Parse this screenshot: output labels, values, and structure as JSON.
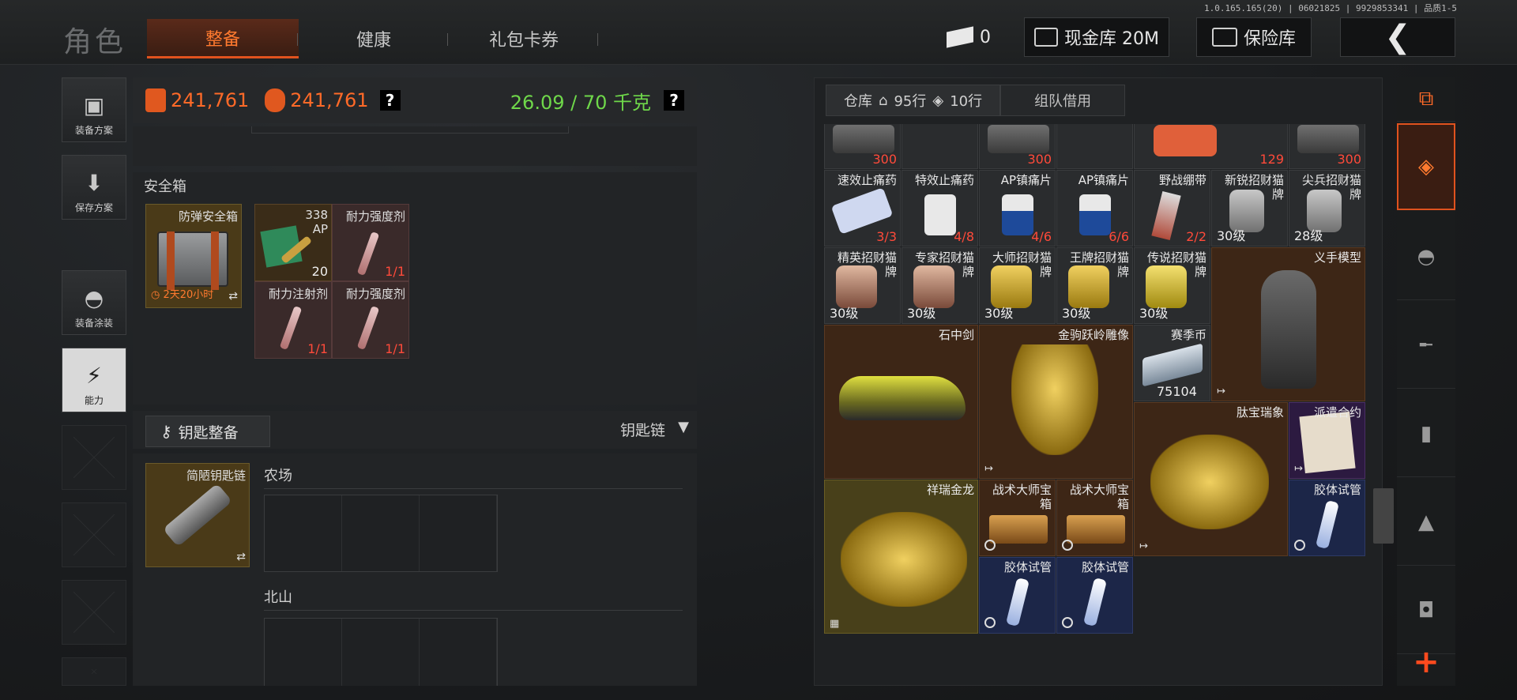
{
  "version": "1.0.165.165(20) | 06021825 | 9929853341 | 品质1-5",
  "title": "角色",
  "tabs": [
    "整备",
    "健康",
    "礼包卡券"
  ],
  "top_right": {
    "tickets_count": "0",
    "cash_vault": "现金库 20M",
    "insurance": "保险库",
    "back_icon": "back-arrow-icon"
  },
  "left_nav": [
    {
      "label": "装备方案",
      "icon": "vest-icon"
    },
    {
      "label": "保存方案",
      "icon": "download-icon"
    },
    {
      "label": "装备涂装",
      "icon": "helmet-icon"
    },
    {
      "label": "能力",
      "icon": "lightning-icon"
    }
  ],
  "stats": {
    "value1": "241,761",
    "value2": "241,761",
    "weight": "26.09 / 70 千克"
  },
  "safe_box": {
    "title": "安全箱",
    "container": {
      "name": "防弹安全箱",
      "timer": "2天20小时"
    },
    "items": [
      {
        "name": "338\nAP",
        "count": "20",
        "white": true
      },
      {
        "name": "耐力强度剂",
        "count": "1/1"
      },
      {
        "name": "耐力注射剂",
        "count": "1/1"
      },
      {
        "name": "耐力强度剂",
        "count": "1/1"
      }
    ]
  },
  "key_section": {
    "button": "钥匙整备",
    "chain_label": "钥匙链",
    "key_name": "简陋钥匙链",
    "maps": [
      "农场",
      "北山"
    ]
  },
  "warehouse": {
    "tab_name": "仓库",
    "rows_a": "95行",
    "rows_b": "10行",
    "team_tab": "组队借用",
    "top_counts": [
      "300",
      "300",
      "129",
      "300"
    ],
    "row1": [
      {
        "name": "速效止痛药",
        "count": "3/3"
      },
      {
        "name": "特效止痛药",
        "count": "4/8"
      },
      {
        "name": "AP镇痛片",
        "count": "4/6"
      },
      {
        "name": "AP镇痛片",
        "count": "6/6"
      },
      {
        "name": "野战绷带",
        "count": "2/2"
      },
      {
        "name": "新锐招财猫\n牌",
        "lv": "30级"
      },
      {
        "name": "尖兵招财猫\n牌",
        "lv": "28级"
      }
    ],
    "row2": [
      {
        "name": "精英招财猫\n牌",
        "lv": "30级"
      },
      {
        "name": "专家招财猫\n牌",
        "lv": "30级"
      },
      {
        "name": "大师招财猫\n牌",
        "lv": "30级"
      },
      {
        "name": "王牌招财猫\n牌",
        "lv": "30级"
      },
      {
        "name": "传说招财猫\n牌",
        "lv": "30级"
      }
    ],
    "prosthetic": "义手模型",
    "sword": "石中剑",
    "horse": "金驹跃岭雕像",
    "coin": {
      "name": "赛季币",
      "count": "75104"
    },
    "elephant": "肽宝瑞象",
    "contract": "派遣合约",
    "dragon": "祥瑞金龙",
    "chest1": "战术大师宝\n箱",
    "chest2": "战术大师宝\n箱",
    "tube1": "胶体试管",
    "tube2": "胶体试管",
    "tube3": "胶体试管"
  },
  "side_icons": [
    "layers-refresh-icon",
    "layers-icon",
    "helmet-icon",
    "rifle-icon",
    "magazine-icon",
    "bullet-icon",
    "sight-icon",
    "plus-icon"
  ],
  "colors": {
    "accent": "#e0521e",
    "weight_green": "#6fd84a",
    "count_red": "#ff4a3a"
  }
}
